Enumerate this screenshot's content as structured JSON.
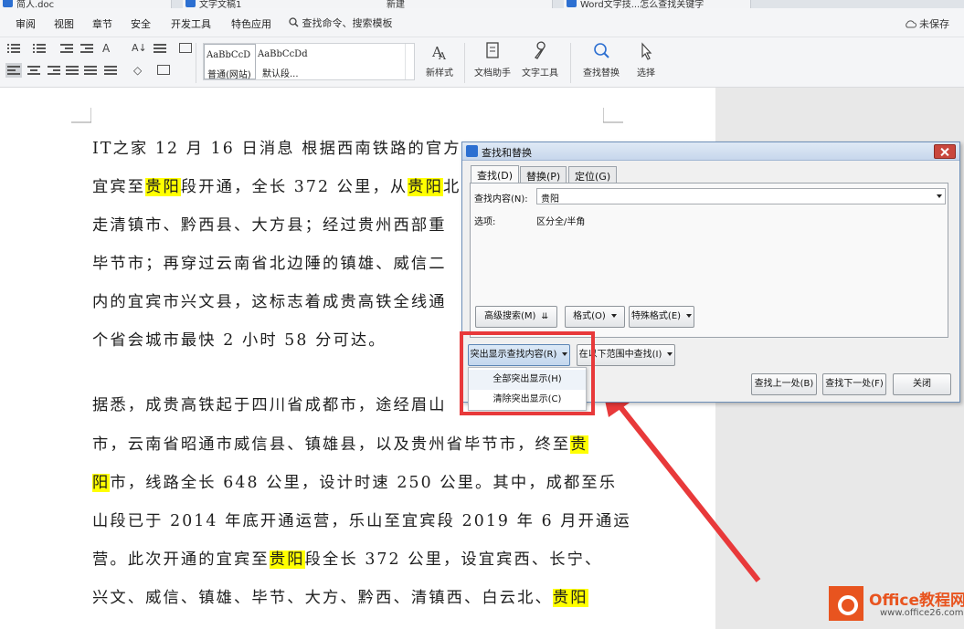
{
  "tabs": [
    {
      "label": "简人.doc"
    },
    {
      "label": "文字文稿1"
    },
    {
      "label": "新建"
    },
    {
      "label": "Word文字技...怎么查找关键字"
    }
  ],
  "menu": {
    "items": [
      "审阅",
      "视图",
      "章节",
      "安全",
      "开发工具",
      "特色应用"
    ],
    "search_text": "查找命令、搜索模板",
    "unsaved": "未保存"
  },
  "ribbon": {
    "styles": [
      {
        "sample": "AaBbCcD",
        "name": "普通(网站)"
      },
      {
        "sample": "AaBbCcDd",
        "name": "默认段..."
      }
    ],
    "buttons": [
      "新样式",
      "文档助手",
      "文字工具",
      "查找替换",
      "选择"
    ]
  },
  "document": {
    "lines": [
      [
        {
          "t": "IT之家 12 月 16 日消息 根据西南铁路的官方"
        }
      ],
      [
        {
          "t": "宜宾至"
        },
        {
          "t": "贵阳",
          "hl": true
        },
        {
          "t": "段开通，全长 372 公里，从"
        },
        {
          "t": "贵阳",
          "hl": true
        },
        {
          "t": "北站"
        }
      ],
      [
        {
          "t": "走清镇市、黔西县、大方县；经过贵州西部重"
        }
      ],
      [
        {
          "t": "毕节市；再穿过云南省北边陲的镇雄、威信二"
        }
      ],
      [
        {
          "t": "内的宜宾市兴文县，这标志着成贵高铁全线通"
        }
      ],
      [
        {
          "t": "个省会城市最快 2 小时 58 分可达。"
        }
      ],
      [
        {
          "t": "据悉，成贵高铁起于四川省成都市，途经眉山"
        }
      ],
      [
        {
          "t": "市，云南省昭通市威信县、镇雄县，以及贵州省毕节市，终至"
        },
        {
          "t": "贵",
          "hl": true
        }
      ],
      [
        {
          "t": "阳",
          "hl": true
        },
        {
          "t": "市，线路全长 648 公里，设计时速 250 公里。其中，成都至乐"
        }
      ],
      [
        {
          "t": "山段已于 2014 年底开通运营，乐山至宜宾段 2019 年 6 月开通运"
        }
      ],
      [
        {
          "t": "营。此次开通的宜宾至"
        },
        {
          "t": "贵阳",
          "hl": true
        },
        {
          "t": "段全长 372 公里，设宜宾西、长宁、"
        }
      ],
      [
        {
          "t": "兴文、威信、镇雄、毕节、大方、黔西、清镇西、白云北、"
        },
        {
          "t": "贵阳",
          "hl": true
        }
      ]
    ]
  },
  "dialog": {
    "title": "查找和替换",
    "tabs": [
      "查找(D)",
      "替换(P)",
      "定位(G)"
    ],
    "find_label": "查找内容(N):",
    "find_value": "贵阳",
    "options_label": "选项:",
    "options_value": "区分全/半角",
    "buttons": {
      "advanced": "高级搜索(M)",
      "format": "格式(O)",
      "special": "特殊格式(E)",
      "highlight": "突出显示查找内容(R)",
      "scope": "在以下范围中查找(I)",
      "find_prev": "查找上一处(B)",
      "find_next": "查找下一处(F)",
      "close": "关闭"
    },
    "highlight_menu": [
      "全部突出显示(H)",
      "清除突出显示(C)"
    ]
  },
  "watermark": {
    "brand": "Office教程网",
    "url": "www.office26.com"
  },
  "colors": {
    "highlight": "#ffff00",
    "annotation": "#e8393a",
    "brand": "#e8541f"
  }
}
